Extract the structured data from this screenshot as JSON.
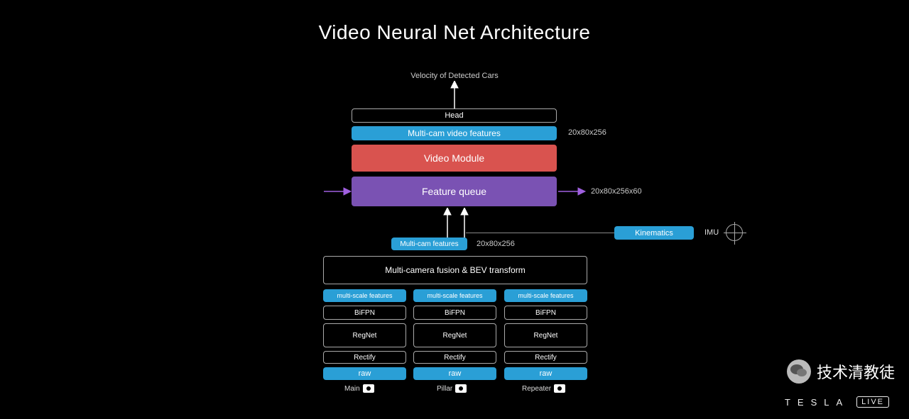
{
  "title": "Video Neural Net Architecture",
  "top_output": "Velocity of Detected Cars",
  "head": "Head",
  "mc_video_feat": {
    "label": "Multi-cam video features",
    "dim": "20x80x256"
  },
  "video_module": "Video Module",
  "feature_queue": {
    "label": "Feature queue",
    "dim": "20x80x256x60"
  },
  "mc_feat": {
    "label": "Multi-cam features",
    "dim": "20x80x256"
  },
  "fusion": "Multi-camera fusion & BEV transform",
  "kinematics": "Kinematics",
  "imu_label": "IMU",
  "columns": {
    "r0": [
      "multi-scale features",
      "multi-scale features",
      "multi-scale features"
    ],
    "r1": [
      "BiFPN",
      "BiFPN",
      "BiFPN"
    ],
    "r2": [
      "RegNet",
      "RegNet",
      "RegNet"
    ],
    "r3": [
      "Rectify",
      "Rectify",
      "Rectify"
    ],
    "r4": [
      "raw",
      "raw",
      "raw"
    ]
  },
  "cameras": [
    "Main",
    "Pillar",
    "Repeater"
  ],
  "watermark": "技术清教徒",
  "brand": "TESLA",
  "live": "LIVE"
}
